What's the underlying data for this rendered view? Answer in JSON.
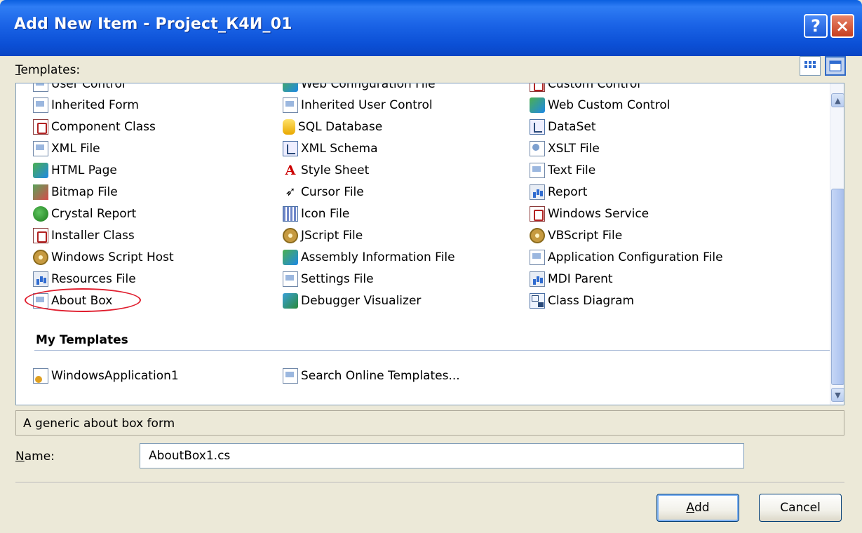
{
  "window": {
    "title": "Add New Item - Project_К4И_01",
    "help_glyph": "?",
    "close_glyph": "×"
  },
  "templates_label": "Templates:",
  "templates_mnemonic": "T",
  "templates_label_rest": "emplates:",
  "view_modes": {
    "large_icons": "large-icons-view",
    "small_icons": "small-icons-view"
  },
  "grid": {
    "partial_row": [
      "User Control",
      "Web Configuration File",
      "Custom Control"
    ],
    "col1": [
      "Inherited Form",
      "Component Class",
      "XML File",
      "HTML Page",
      "Bitmap File",
      "Crystal Report",
      "Installer Class",
      "Windows Script Host",
      "Resources File",
      "About Box"
    ],
    "col2": [
      "Inherited User Control",
      "SQL Database",
      "XML Schema",
      "Style Sheet",
      "Cursor File",
      "Icon File",
      "JScript File",
      "Assembly Information File",
      "Settings File",
      "Debugger Visualizer"
    ],
    "col3": [
      "Web Custom Control",
      "DataSet",
      "XSLT File",
      "Text File",
      "Report",
      "Windows Service",
      "VBScript File",
      "Application Configuration File",
      "MDI Parent",
      "Class Diagram"
    ]
  },
  "my_templates": {
    "heading": "My Templates",
    "items": [
      "WindowsApplication1",
      "Search Online Templates..."
    ]
  },
  "selected_item": "About Box",
  "description": "A generic about box form",
  "name_field": {
    "label_mnemonic": "N",
    "label_rest": "ame:",
    "value": "AboutBox1.cs"
  },
  "buttons": {
    "add_mnemonic": "A",
    "add_rest": "dd",
    "cancel": "Cancel"
  }
}
